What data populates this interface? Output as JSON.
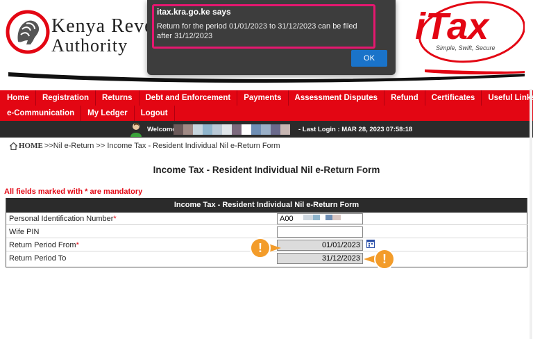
{
  "header": {
    "org_line1": "Kenya Revenue",
    "org_line2": "Authority",
    "itax_brand": "iTax",
    "itax_tagline": "Simple, Swift, Secure"
  },
  "menu": {
    "row1": [
      "Home",
      "Registration",
      "Returns",
      "Debt and Enforcement",
      "Payments",
      "Assessment Disputes",
      "Refund",
      "Certificates",
      "Useful Links"
    ],
    "row2": [
      "e-Communication",
      "My Ledger",
      "Logout"
    ]
  },
  "welcome_bar": {
    "welcome_label": "Welcome",
    "last_login": "- Last Login : MAR 28, 2023 07:58:18",
    "redacted_colors": [
      "#6b5a5a",
      "#a08a85",
      "#c7d6de",
      "#8fb5cc",
      "#b9c9d6",
      "#e0e6ea",
      "#7c6a7e",
      "#ffffff",
      "#6f8fb5",
      "#9ab0c8",
      "#6a6a8c",
      "#c7b6b2"
    ]
  },
  "breadcrumb": {
    "home": "HOME",
    "trail": ">>Nil e-Return >> Income Tax - Resident Individual Nil e-Return Form"
  },
  "page_title": "Income Tax - Resident Individual Nil e-Return Form",
  "mandatory_note": "All fields marked with * are mandatory",
  "form": {
    "header": "Income Tax - Resident Individual Nil e-Return Form",
    "fields": [
      {
        "label": "Personal Identification Number",
        "required": "*",
        "value": "A00",
        "readonly": false
      },
      {
        "label": "Wife PIN",
        "required": "",
        "value": "",
        "readonly": false
      },
      {
        "label": "Return Period From",
        "required": "*",
        "value": "01/01/2023",
        "readonly": true
      },
      {
        "label": "Return Period To",
        "required": "",
        "value": "31/12/2023",
        "readonly": true
      }
    ]
  },
  "markers": {
    "symbol": "!",
    "color": "#f39c2a"
  },
  "dialog": {
    "title": "itax.kra.go.ke says",
    "message": "Return for the period 01/01/2023 to 31/12/2023 can be filed after 31/12/2023",
    "ok_label": "OK"
  },
  "colors": {
    "brand_red": "#e30613",
    "dark_bar": "#2b2b2b",
    "dialog_bg": "#3d3d3d",
    "highlight": "#e5176f",
    "ok_blue": "#1a73c9"
  }
}
